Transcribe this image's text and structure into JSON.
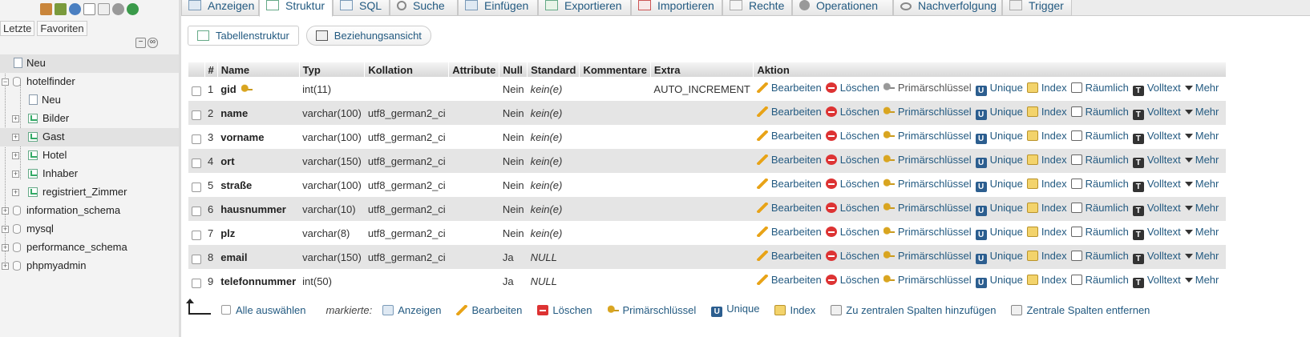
{
  "sidebar": {
    "tabs": [
      "Letzte",
      "Favoriten"
    ],
    "tree": [
      {
        "label": "Neu",
        "kind": "new",
        "level": 0,
        "highlight": true
      },
      {
        "label": "hotelfinder",
        "kind": "db",
        "level": 0,
        "expanded": true
      },
      {
        "label": "Neu",
        "kind": "new",
        "level": 1
      },
      {
        "label": "Bilder",
        "kind": "table",
        "level": 1
      },
      {
        "label": "Gast",
        "kind": "table",
        "level": 1,
        "highlight": true
      },
      {
        "label": "Hotel",
        "kind": "table",
        "level": 1
      },
      {
        "label": "Inhaber",
        "kind": "table",
        "level": 1
      },
      {
        "label": "registriert_Zimmer",
        "kind": "table",
        "level": 1
      },
      {
        "label": "information_schema",
        "kind": "db",
        "level": 0
      },
      {
        "label": "mysql",
        "kind": "db",
        "level": 0
      },
      {
        "label": "performance_schema",
        "kind": "db",
        "level": 0
      },
      {
        "label": "phpmyadmin",
        "kind": "db",
        "level": 0
      }
    ]
  },
  "tabs": [
    {
      "label": "Anzeigen",
      "icon": "browse-icon"
    },
    {
      "label": "Struktur",
      "icon": "structure-icon",
      "active": true
    },
    {
      "label": "SQL",
      "icon": "sql-icon"
    },
    {
      "label": "Suche",
      "icon": "search-icon"
    },
    {
      "label": "Einfügen",
      "icon": "insert-icon"
    },
    {
      "label": "Exportieren",
      "icon": "export-icon"
    },
    {
      "label": "Importieren",
      "icon": "import-icon"
    },
    {
      "label": "Rechte",
      "icon": "privileges-icon"
    },
    {
      "label": "Operationen",
      "icon": "operations-icon"
    },
    {
      "label": "Nachverfolgung",
      "icon": "tracking-icon"
    },
    {
      "label": "Trigger",
      "icon": "trigger-icon"
    }
  ],
  "subtabs": [
    {
      "label": "Tabellenstruktur",
      "active": true
    },
    {
      "label": "Beziehungsansicht"
    }
  ],
  "table": {
    "headers": [
      "#",
      "Name",
      "Typ",
      "Kollation",
      "Attribute",
      "Null",
      "Standard",
      "Kommentare",
      "Extra",
      "Aktion"
    ],
    "actions": [
      "Bearbeiten",
      "Löschen",
      "Primärschlüssel",
      "Unique",
      "Index",
      "Räumlich",
      "Volltext",
      "Mehr"
    ],
    "rows": [
      {
        "num": "1",
        "name": "gid",
        "primary": true,
        "type": "int(11)",
        "collation": "",
        "attribute": "",
        "null": "Nein",
        "default": "kein(e)",
        "comment": "",
        "extra": "AUTO_INCREMENT"
      },
      {
        "num": "2",
        "name": "name",
        "type": "varchar(100)",
        "collation": "utf8_german2_ci",
        "attribute": "",
        "null": "Nein",
        "default": "kein(e)",
        "comment": "",
        "extra": ""
      },
      {
        "num": "3",
        "name": "vorname",
        "type": "varchar(100)",
        "collation": "utf8_german2_ci",
        "attribute": "",
        "null": "Nein",
        "default": "kein(e)",
        "comment": "",
        "extra": ""
      },
      {
        "num": "4",
        "name": "ort",
        "type": "varchar(150)",
        "collation": "utf8_german2_ci",
        "attribute": "",
        "null": "Nein",
        "default": "kein(e)",
        "comment": "",
        "extra": ""
      },
      {
        "num": "5",
        "name": "straße",
        "type": "varchar(100)",
        "collation": "utf8_german2_ci",
        "attribute": "",
        "null": "Nein",
        "default": "kein(e)",
        "comment": "",
        "extra": ""
      },
      {
        "num": "6",
        "name": "hausnummer",
        "type": "varchar(10)",
        "collation": "utf8_german2_ci",
        "attribute": "",
        "null": "Nein",
        "default": "kein(e)",
        "comment": "",
        "extra": ""
      },
      {
        "num": "7",
        "name": "plz",
        "type": "varchar(8)",
        "collation": "utf8_german2_ci",
        "attribute": "",
        "null": "Nein",
        "default": "kein(e)",
        "comment": "",
        "extra": ""
      },
      {
        "num": "8",
        "name": "email",
        "type": "varchar(150)",
        "collation": "utf8_german2_ci",
        "attribute": "",
        "null": "Ja",
        "default": "NULL",
        "comment": "",
        "extra": ""
      },
      {
        "num": "9",
        "name": "telefonnummer",
        "type": "int(50)",
        "collation": "",
        "attribute": "",
        "null": "Ja",
        "default": "NULL",
        "comment": "",
        "extra": ""
      }
    ]
  },
  "bottom": {
    "select_all": "Alle auswählen",
    "marked_label": "markierte:",
    "actions": [
      "Anzeigen",
      "Bearbeiten",
      "Löschen",
      "Primärschlüssel",
      "Unique",
      "Index",
      "Zu zentralen Spalten hinzufügen",
      "Zentrale Spalten entfernen"
    ]
  }
}
